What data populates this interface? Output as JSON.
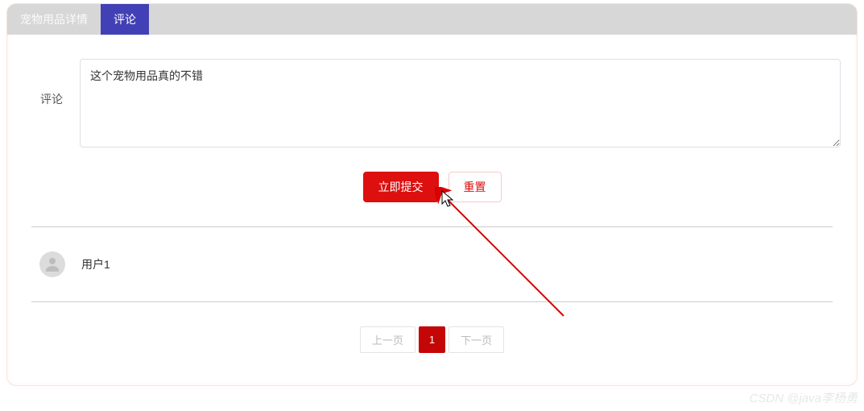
{
  "tabs": {
    "detail": "宠物用品详情",
    "comment": "评论"
  },
  "form": {
    "label": "评论",
    "value": "这个宠物用品真的不错",
    "submit_label": "立即提交",
    "reset_label": "重置"
  },
  "comments": [
    {
      "username": "用户1"
    }
  ],
  "pager": {
    "prev": "上一页",
    "next": "下一页",
    "current": "1"
  },
  "watermark": "CSDN @java李杨勇"
}
